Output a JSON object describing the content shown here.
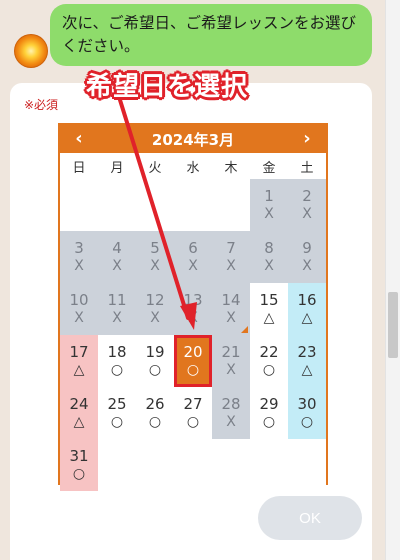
{
  "chat": {
    "message": "次に、ご希望日、ご希望レッスンをお選びください。"
  },
  "annotation": {
    "callout": "希望日を選択"
  },
  "form": {
    "required_label": "※必須",
    "ok_label": "OK"
  },
  "calendar": {
    "title": "2024年3月",
    "prev": "‹",
    "next": "›",
    "weekdays": [
      "日",
      "月",
      "火",
      "水",
      "木",
      "金",
      "土"
    ],
    "weeks": [
      [
        {
          "day": "",
          "mark": "",
          "state": "blank"
        },
        {
          "day": "",
          "mark": "",
          "state": "blank"
        },
        {
          "day": "",
          "mark": "",
          "state": "blank"
        },
        {
          "day": "",
          "mark": "",
          "state": "blank"
        },
        {
          "day": "",
          "mark": "",
          "state": "blank"
        },
        {
          "day": "1",
          "mark": "X",
          "state": "unavail"
        },
        {
          "day": "2",
          "mark": "X",
          "state": "unavail"
        }
      ],
      [
        {
          "day": "3",
          "mark": "X",
          "state": "unavail"
        },
        {
          "day": "4",
          "mark": "X",
          "state": "unavail"
        },
        {
          "day": "5",
          "mark": "X",
          "state": "unavail"
        },
        {
          "day": "6",
          "mark": "X",
          "state": "unavail"
        },
        {
          "day": "7",
          "mark": "X",
          "state": "unavail"
        },
        {
          "day": "8",
          "mark": "X",
          "state": "unavail"
        },
        {
          "day": "9",
          "mark": "X",
          "state": "unavail"
        }
      ],
      [
        {
          "day": "10",
          "mark": "X",
          "state": "unavail"
        },
        {
          "day": "11",
          "mark": "X",
          "state": "unavail"
        },
        {
          "day": "12",
          "mark": "X",
          "state": "unavail"
        },
        {
          "day": "13",
          "mark": "X",
          "state": "unavail"
        },
        {
          "day": "14",
          "mark": "X",
          "state": "unavail",
          "corner": true
        },
        {
          "day": "15",
          "mark": "△",
          "state": "normal"
        },
        {
          "day": "16",
          "mark": "△",
          "state": "sat"
        }
      ],
      [
        {
          "day": "17",
          "mark": "△",
          "state": "sun"
        },
        {
          "day": "18",
          "mark": "○",
          "state": "normal"
        },
        {
          "day": "19",
          "mark": "○",
          "state": "normal"
        },
        {
          "day": "20",
          "mark": "○",
          "state": "selected"
        },
        {
          "day": "21",
          "mark": "X",
          "state": "unavail"
        },
        {
          "day": "22",
          "mark": "○",
          "state": "normal"
        },
        {
          "day": "23",
          "mark": "△",
          "state": "sat"
        }
      ],
      [
        {
          "day": "24",
          "mark": "△",
          "state": "sun"
        },
        {
          "day": "25",
          "mark": "○",
          "state": "normal"
        },
        {
          "day": "26",
          "mark": "○",
          "state": "normal"
        },
        {
          "day": "27",
          "mark": "○",
          "state": "normal"
        },
        {
          "day": "28",
          "mark": "X",
          "state": "unavail"
        },
        {
          "day": "29",
          "mark": "○",
          "state": "normal"
        },
        {
          "day": "30",
          "mark": "○",
          "state": "sat"
        }
      ],
      [
        {
          "day": "31",
          "mark": "○",
          "state": "sun"
        },
        {
          "day": "",
          "mark": "",
          "state": "blank"
        },
        {
          "day": "",
          "mark": "",
          "state": "blank"
        },
        {
          "day": "",
          "mark": "",
          "state": "blank"
        },
        {
          "day": "",
          "mark": "",
          "state": "blank"
        },
        {
          "day": "",
          "mark": "",
          "state": "blank"
        },
        {
          "day": "",
          "mark": "",
          "state": "blank"
        }
      ]
    ]
  },
  "colors": {
    "accent": "#e1761e",
    "annotation_red": "#e0222a",
    "bubble_green": "#8edc6b",
    "unavailable_gray": "#ccd2da",
    "saturday_blue": "#c3ecf7",
    "sunday_pink": "#f7c3c3"
  }
}
